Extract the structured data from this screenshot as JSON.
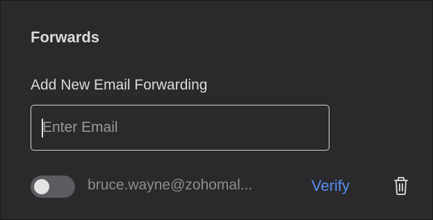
{
  "forwards": {
    "section_title": "Forwards",
    "add_label": "Add New Email Forwarding",
    "email_input": {
      "placeholder": "Enter Email",
      "value": ""
    },
    "entries": [
      {
        "email": "bruce.wayne@zohomal...",
        "enabled": false,
        "verify_label": "Verify",
        "delete_icon": "trash-icon"
      }
    ]
  },
  "colors": {
    "background": "#2a2a2d",
    "accent_link": "#5a8ef0",
    "toggle_off": "#5c5c60"
  }
}
